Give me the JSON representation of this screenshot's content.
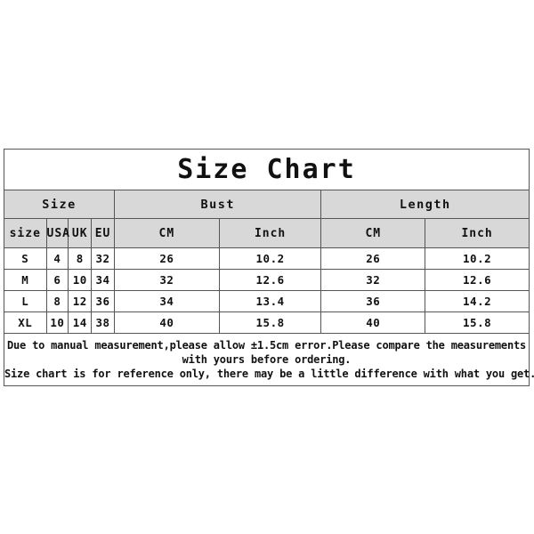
{
  "document": {
    "title": "Size Chart",
    "background_color": "#ffffff",
    "header_fill": "#d8d8d8",
    "border_color": "#555555",
    "text_color": "#111111"
  },
  "chart_data": {
    "type": "table",
    "title": "Size Chart",
    "group_headers": [
      {
        "label": "Size",
        "span": 4
      },
      {
        "label": "Bust",
        "span": 2
      },
      {
        "label": "Length",
        "span": 2
      }
    ],
    "columns": [
      "size",
      "USA",
      "UK",
      "EU",
      "CM",
      "Inch",
      "CM",
      "Inch"
    ],
    "rows": [
      [
        "S",
        "4",
        "8",
        "32",
        "26",
        "10.2",
        "26",
        "10.2"
      ],
      [
        "M",
        "6",
        "10",
        "34",
        "32",
        "12.6",
        "32",
        "12.6"
      ],
      [
        "L",
        "8",
        "12",
        "36",
        "34",
        "13.4",
        "36",
        "14.2"
      ],
      [
        "XL",
        "10",
        "14",
        "38",
        "40",
        "15.8",
        "40",
        "15.8"
      ]
    ]
  },
  "notes": {
    "line1": "Due to manual measurement,please allow ±1.5cm error.Please compare the measurements",
    "line2": "with yours before ordering.",
    "line3": "Size chart is for reference only, there may be a little difference with what you get."
  }
}
